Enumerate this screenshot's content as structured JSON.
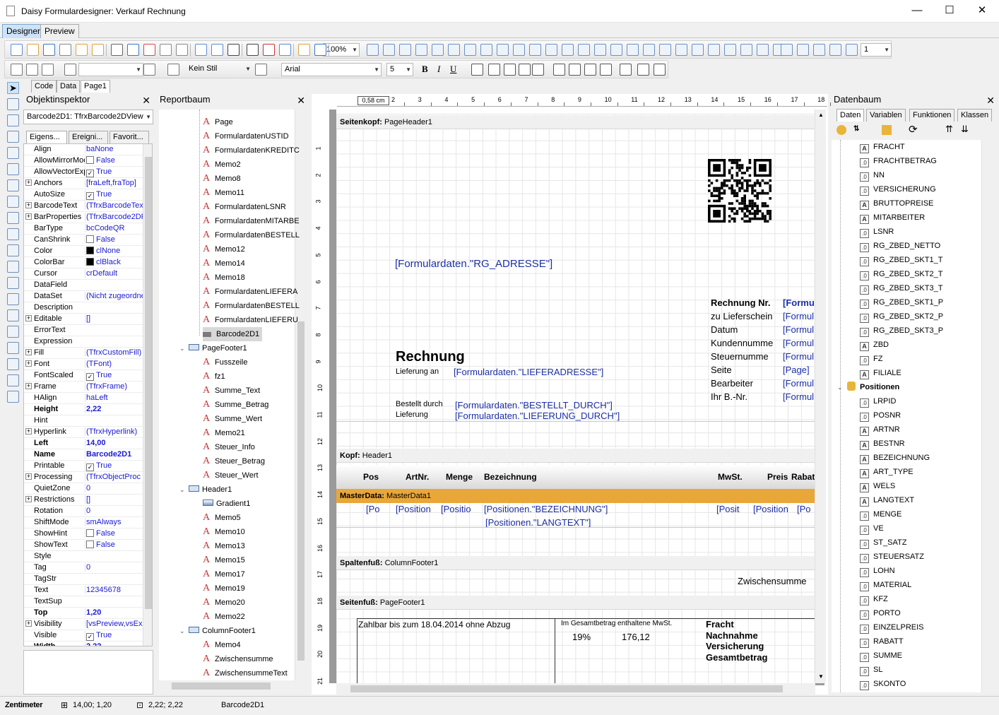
{
  "window": {
    "title": "Daisy Formulardesigner: Verkauf Rechnung",
    "minimize": "—",
    "maximize": "☐",
    "close": "✕"
  },
  "main_tabs": [
    "Designer",
    "Preview"
  ],
  "toolbar2": {
    "zoom": "100%",
    "style": "Kein Stil",
    "font": "Arial",
    "font_size": "5",
    "line_width": "1"
  },
  "doc_tabs": [
    "Code",
    "Data",
    "Page1"
  ],
  "object_inspector": {
    "title": "Objektinspektor",
    "selected": "Barcode2D1: TfrxBarcode2DView",
    "tabs": [
      "Eigens...",
      "Ereigni...",
      "Favorit..."
    ],
    "props": [
      {
        "n": "Align",
        "v": "baNone"
      },
      {
        "n": "AllowMirrorMoc",
        "v": "False",
        "c": "unchecked"
      },
      {
        "n": "AllowVectorExp",
        "v": "True",
        "c": "checked"
      },
      {
        "n": "Anchors",
        "v": "[fraLeft,fraTop]",
        "p": true
      },
      {
        "n": "AutoSize",
        "v": "True",
        "c": "checked"
      },
      {
        "n": "BarcodeText",
        "v": "(TfrxBarcodeTex",
        "p": true
      },
      {
        "n": "BarProperties",
        "v": "(TfrxBarcode2DP",
        "p": true
      },
      {
        "n": "BarType",
        "v": "bcCodeQR"
      },
      {
        "n": "CanShrink",
        "v": "False",
        "c": "unchecked"
      },
      {
        "n": "Color",
        "v": "clNone",
        "s": "black"
      },
      {
        "n": "ColorBar",
        "v": "clBlack",
        "s": "black"
      },
      {
        "n": "Cursor",
        "v": "crDefault"
      },
      {
        "n": "DataField",
        "v": ""
      },
      {
        "n": "DataSet",
        "v": "(Nicht zugeordne"
      },
      {
        "n": "Description",
        "v": ""
      },
      {
        "n": "Editable",
        "v": "[]",
        "p": true
      },
      {
        "n": "ErrorText",
        "v": ""
      },
      {
        "n": "Expression",
        "v": ""
      },
      {
        "n": "Fill",
        "v": "(TfrxCustomFill)",
        "p": true
      },
      {
        "n": "Font",
        "v": "(TFont)",
        "p": true
      },
      {
        "n": "FontScaled",
        "v": "True",
        "c": "checked"
      },
      {
        "n": "Frame",
        "v": "(TfrxFrame)",
        "p": true
      },
      {
        "n": "HAlign",
        "v": "haLeft"
      },
      {
        "n": "Height",
        "v": "2,22",
        "b": true
      },
      {
        "n": "Hint",
        "v": ""
      },
      {
        "n": "Hyperlink",
        "v": "(TfrxHyperlink)",
        "p": true
      },
      {
        "n": "Left",
        "v": "14,00",
        "b": true
      },
      {
        "n": "Name",
        "v": "Barcode2D1",
        "b": true
      },
      {
        "n": "Printable",
        "v": "True",
        "c": "checked"
      },
      {
        "n": "Processing",
        "v": "(TfrxObjectProc",
        "p": true
      },
      {
        "n": "QuietZone",
        "v": "0"
      },
      {
        "n": "Restrictions",
        "v": "[]",
        "p": true
      },
      {
        "n": "Rotation",
        "v": "0"
      },
      {
        "n": "ShiftMode",
        "v": "smAlways"
      },
      {
        "n": "ShowHint",
        "v": "False",
        "c": "unchecked"
      },
      {
        "n": "ShowText",
        "v": "False",
        "c": "unchecked"
      },
      {
        "n": "Style",
        "v": ""
      },
      {
        "n": "Tag",
        "v": "0"
      },
      {
        "n": "TagStr",
        "v": ""
      },
      {
        "n": "Text",
        "v": "12345678"
      },
      {
        "n": "TextSup",
        "v": ""
      },
      {
        "n": "Top",
        "v": "1,20",
        "b": true
      },
      {
        "n": "Visibility",
        "v": "[vsPreview,vsEx",
        "p": true
      },
      {
        "n": "Visible",
        "v": "True",
        "c": "checked"
      },
      {
        "n": "Width",
        "v": "2,22",
        "b": true
      }
    ]
  },
  "report_tree": {
    "title": "Reportbaum",
    "items": [
      {
        "t": "Page",
        "k": "a",
        "l": 1
      },
      {
        "t": "FormulardatenUSTID",
        "k": "a",
        "l": 1
      },
      {
        "t": "FormulardatenKREDITC",
        "k": "a",
        "l": 1
      },
      {
        "t": "Memo2",
        "k": "a",
        "l": 1
      },
      {
        "t": "Memo8",
        "k": "a",
        "l": 1
      },
      {
        "t": "Memo11",
        "k": "a",
        "l": 1
      },
      {
        "t": "FormulardatenLSNR",
        "k": "a",
        "l": 1
      },
      {
        "t": "FormulardatenMITARBE",
        "k": "a",
        "l": 1
      },
      {
        "t": "FormulardatenBESTELL",
        "k": "a",
        "l": 1
      },
      {
        "t": "Memo12",
        "k": "a",
        "l": 1
      },
      {
        "t": "Memo14",
        "k": "a",
        "l": 1
      },
      {
        "t": "Memo18",
        "k": "a",
        "l": 1
      },
      {
        "t": "FormulardatenLIEFERA",
        "k": "a",
        "l": 1
      },
      {
        "t": "FormulardatenBESTELL",
        "k": "a",
        "l": 1
      },
      {
        "t": "FormulardatenLIEFERU",
        "k": "a",
        "l": 1
      },
      {
        "t": "Barcode2D1",
        "k": "bc",
        "l": 1
      },
      {
        "t": "PageFooter1",
        "k": "b",
        "l": 0
      },
      {
        "t": "Fusszeile",
        "k": "a",
        "l": 1
      },
      {
        "t": "fz1",
        "k": "a",
        "l": 1
      },
      {
        "t": "Summe_Text",
        "k": "a",
        "l": 1
      },
      {
        "t": "Summe_Betrag",
        "k": "a",
        "l": 1
      },
      {
        "t": "Summe_Wert",
        "k": "a",
        "l": 1
      },
      {
        "t": "Memo21",
        "k": "a",
        "l": 1
      },
      {
        "t": "Steuer_Info",
        "k": "a",
        "l": 1
      },
      {
        "t": "Steuer_Betrag",
        "k": "a",
        "l": 1
      },
      {
        "t": "Steuer_Wert",
        "k": "a",
        "l": 1
      },
      {
        "t": "Header1",
        "k": "b",
        "l": 0
      },
      {
        "t": "Gradient1",
        "k": "g",
        "l": 1
      },
      {
        "t": "Memo5",
        "k": "a",
        "l": 1
      },
      {
        "t": "Memo10",
        "k": "a",
        "l": 1
      },
      {
        "t": "Memo13",
        "k": "a",
        "l": 1
      },
      {
        "t": "Memo15",
        "k": "a",
        "l": 1
      },
      {
        "t": "Memo17",
        "k": "a",
        "l": 1
      },
      {
        "t": "Memo19",
        "k": "a",
        "l": 1
      },
      {
        "t": "Memo20",
        "k": "a",
        "l": 1
      },
      {
        "t": "Memo22",
        "k": "a",
        "l": 1
      },
      {
        "t": "ColumnFooter1",
        "k": "b",
        "l": 0
      },
      {
        "t": "Memo4",
        "k": "a",
        "l": 1
      },
      {
        "t": "Zwischensumme",
        "k": "a",
        "l": 1
      },
      {
        "t": "ZwischensummeText",
        "k": "a",
        "l": 1
      }
    ]
  },
  "ruler": {
    "h_indicator": "0,58 cm",
    "h_ticks": [
      "2",
      "3",
      "4",
      "5",
      "6",
      "7",
      "8",
      "9",
      "10",
      "11",
      "12",
      "13",
      "14",
      "15",
      "16",
      "17",
      "18"
    ],
    "v_ticks": [
      "1",
      "2",
      "3",
      "4",
      "5",
      "6",
      "7",
      "8",
      "9",
      "10",
      "11",
      "12",
      "13",
      "14",
      "15",
      "16",
      "17",
      "18",
      "19",
      "20",
      "21"
    ]
  },
  "report": {
    "bands": {
      "page_header": [
        "Seitenkopf:",
        "PageHeader1"
      ],
      "header": [
        "Kopf:",
        "Header1"
      ],
      "master": [
        "MasterData:",
        "MasterData1"
      ],
      "col_footer": [
        "Spaltenfuß:",
        "ColumnFooter1"
      ],
      "page_footer": [
        "Seitenfuß:",
        "PageFooter1"
      ]
    },
    "rg_adresse": "[Formulardaten.\"RG_ADRESSE\"]",
    "rechnung": "Rechnung",
    "lieferung_an": "Lieferung an",
    "lieferadresse": "[Formulardaten.\"LIEFERADRESSE\"]",
    "bestellt_durch": "Bestellt durch",
    "lieferung": "Lieferung",
    "bestellt_durch_val": "[Formulardaten.\"BESTELLT_DURCH\"]",
    "lieferung_durch_val": "[Formulardaten.\"LIEFERUNG_DURCH\"]",
    "info_labels": [
      "Rechnung Nr.",
      "zu Lieferschein",
      "Datum",
      "Kundennumme",
      "Steuernumme",
      "Seite",
      "Bearbeiter",
      "Ihr B.-Nr."
    ],
    "info_values": [
      "[Formu",
      "[Formul",
      "[Formul",
      "[Formul",
      "[Formul",
      "[Page]",
      "[Formul",
      "[Formul"
    ],
    "columns": [
      "Pos",
      "ArtNr.",
      "Menge",
      "Bezeichnung",
      "MwSt.",
      "Preis",
      "Rabat"
    ],
    "row_vals": [
      "[Po",
      "[Position",
      "[Positio",
      "[Positionen.\"BEZEICHNUNG\"]",
      "[Posit",
      "[Position",
      "[Po"
    ],
    "langtext": "[Positionen.\"LANGTEXT\"]",
    "zwischensumme": "Zwischensumme",
    "zahlbar": "Zahlbar bis zum 18.04.2014 ohne Abzug",
    "mwst_title": "Im Gesamtbetrag enthaltene MwSt.",
    "mwst_pct": "19%",
    "mwst_val": "176,12",
    "totals": [
      "Fracht",
      "Nachnahme",
      "Versicherung",
      "Gesamtbetrag"
    ]
  },
  "datenbaum": {
    "title": "Datenbaum",
    "tabs": [
      "Daten",
      "Variablen",
      "Funktionen",
      "Klassen"
    ],
    "items": [
      {
        "t": "FRACHT",
        "i": "A"
      },
      {
        "t": "FRACHTBETRAG",
        "i": ".0"
      },
      {
        "t": "NN",
        "i": ".0"
      },
      {
        "t": "VERSICHERUNG",
        "i": ".0"
      },
      {
        "t": "BRUTTOPREISE",
        "i": "A"
      },
      {
        "t": "MITARBEITER",
        "i": "A"
      },
      {
        "t": "LSNR",
        "i": ".0"
      },
      {
        "t": "RG_ZBED_NETTO",
        "i": ".0"
      },
      {
        "t": "RG_ZBED_SKT1_T",
        "i": ".0"
      },
      {
        "t": "RG_ZBED_SKT2_T",
        "i": ".0"
      },
      {
        "t": "RG_ZBED_SKT3_T",
        "i": ".0"
      },
      {
        "t": "RG_ZBED_SKT1_P",
        "i": ".0"
      },
      {
        "t": "RG_ZBED_SKT2_P",
        "i": ".0"
      },
      {
        "t": "RG_ZBED_SKT3_P",
        "i": ".0"
      },
      {
        "t": "ZBD",
        "i": "A"
      },
      {
        "t": "FZ",
        "i": ".0"
      },
      {
        "t": "FILIALE",
        "i": "A"
      },
      {
        "t": "Positionen",
        "i": "db"
      },
      {
        "t": "LRPID",
        "i": ".0"
      },
      {
        "t": "POSNR",
        "i": ".0"
      },
      {
        "t": "ARTNR",
        "i": "A"
      },
      {
        "t": "BESTNR",
        "i": "A"
      },
      {
        "t": "BEZEICHNUNG",
        "i": "A"
      },
      {
        "t": "ART_TYPE",
        "i": "A"
      },
      {
        "t": "WELS",
        "i": "A"
      },
      {
        "t": "LANGTEXT",
        "i": "A"
      },
      {
        "t": "MENGE",
        "i": ".0"
      },
      {
        "t": "VE",
        "i": ".0"
      },
      {
        "t": "ST_SATZ",
        "i": ".0"
      },
      {
        "t": "STEUERSATZ",
        "i": ".0"
      },
      {
        "t": "LOHN",
        "i": ".0"
      },
      {
        "t": "MATERIAL",
        "i": ".0"
      },
      {
        "t": "KFZ",
        "i": ".0"
      },
      {
        "t": "PORTO",
        "i": ".0"
      },
      {
        "t": "EINZELPREIS",
        "i": ".0"
      },
      {
        "t": "RABATT",
        "i": ".0"
      },
      {
        "t": "SUMME",
        "i": ".0"
      },
      {
        "t": "SL",
        "i": ".0"
      },
      {
        "t": "SKONTO",
        "i": ".0"
      }
    ]
  },
  "status": {
    "units": "Zentimeter",
    "pos": "14,00; 1,20",
    "size": "2,22; 2,22",
    "object": "Barcode2D1"
  },
  "colors": {
    "accent": "#cde3f7",
    "master_band": "#e9a73a",
    "field_blue": "#1c2fa5",
    "icon_red": "#c23838"
  }
}
